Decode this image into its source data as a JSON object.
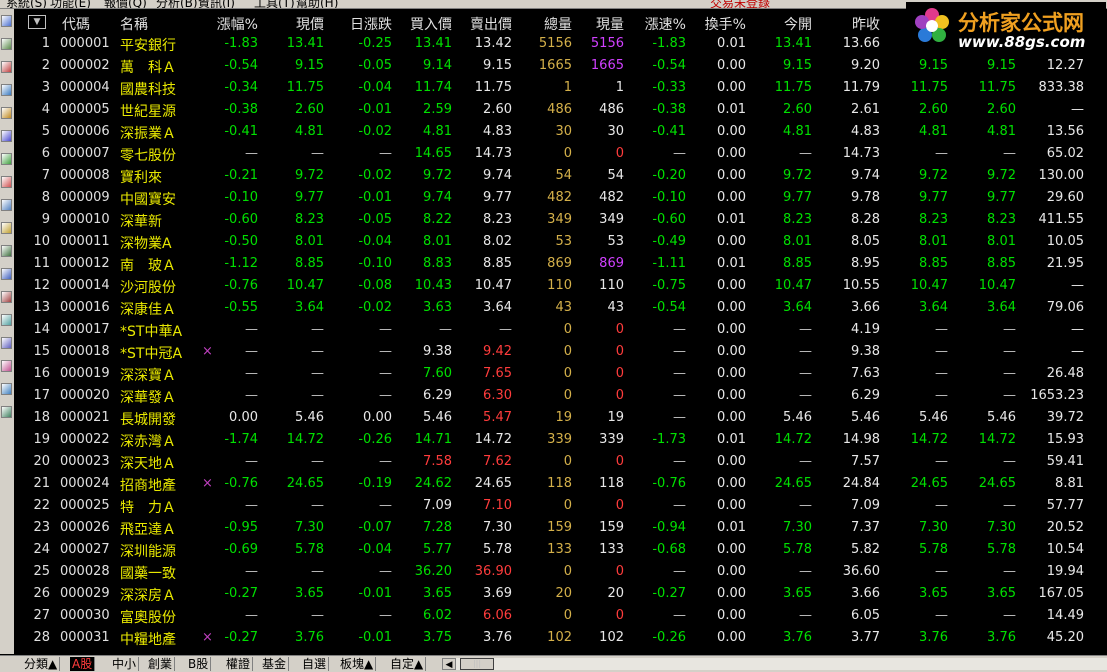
{
  "menubar": {
    "items": [
      "系統(S)",
      "功能(E)",
      "報價(Q)",
      "分析(B)",
      "資訊(I)",
      "工具(T)",
      "幫助(H)"
    ],
    "trade_login": "交易未登錄"
  },
  "logo": {
    "text": "分析家公式网",
    "url": "www.88gs.com"
  },
  "header": {
    "sort_icon": "▼",
    "columns": [
      "代碼",
      "名稱",
      "漲幅%",
      "現價",
      "日漲跌",
      "買入價",
      "賣出價",
      "總量",
      "現量",
      "漲速%",
      "換手%",
      "今開",
      "昨收"
    ]
  },
  "rows": [
    {
      "seq": "1",
      "code": "000001",
      "name": "平安銀行",
      "mark": "",
      "pct": "-1.83",
      "price": "13.41",
      "chg": "-0.25",
      "bid": "13.41",
      "ask": "13.42",
      "vol": "5156",
      "cur": "5156",
      "spd": "-1.83",
      "turn": "0.01",
      "open": "13.41",
      "prev": "13.66",
      "h": "",
      "l": "",
      "x": ""
    },
    {
      "seq": "2",
      "code": "000002",
      "name": "萬　科Ａ",
      "mark": "",
      "pct": "-0.54",
      "price": "9.15",
      "chg": "-0.05",
      "bid": "9.14",
      "ask": "9.15",
      "vol": "1665",
      "cur": "1665",
      "spd": "-0.54",
      "turn": "0.00",
      "open": "9.15",
      "prev": "9.20",
      "h": "9.15",
      "l": "9.15",
      "x": "12.27"
    },
    {
      "seq": "3",
      "code": "000004",
      "name": "國農科技",
      "mark": "",
      "pct": "-0.34",
      "price": "11.75",
      "chg": "-0.04",
      "bid": "11.74",
      "ask": "11.75",
      "vol": "1",
      "cur": "1",
      "spd": "-0.33",
      "turn": "0.00",
      "open": "11.75",
      "prev": "11.79",
      "h": "11.75",
      "l": "11.75",
      "x": "833.38"
    },
    {
      "seq": "4",
      "code": "000005",
      "name": "世紀星源",
      "mark": "",
      "pct": "-0.38",
      "price": "2.60",
      "chg": "-0.01",
      "bid": "2.59",
      "ask": "2.60",
      "vol": "486",
      "cur": "486",
      "spd": "-0.38",
      "turn": "0.01",
      "open": "2.60",
      "prev": "2.61",
      "h": "2.60",
      "l": "2.60",
      "x": "—"
    },
    {
      "seq": "5",
      "code": "000006",
      "name": "深振業Ａ",
      "mark": "",
      "pct": "-0.41",
      "price": "4.81",
      "chg": "-0.02",
      "bid": "4.81",
      "ask": "4.83",
      "vol": "30",
      "cur": "30",
      "spd": "-0.41",
      "turn": "0.00",
      "open": "4.81",
      "prev": "4.83",
      "h": "4.81",
      "l": "4.81",
      "x": "13.56"
    },
    {
      "seq": "6",
      "code": "000007",
      "name": "零七股份",
      "mark": "",
      "pct": "—",
      "price": "—",
      "chg": "—",
      "bid": "14.65",
      "ask": "14.73",
      "vol": "0",
      "cur": "0",
      "spd": "—",
      "turn": "0.00",
      "open": "—",
      "prev": "14.73",
      "h": "—",
      "l": "—",
      "x": "65.02"
    },
    {
      "seq": "7",
      "code": "000008",
      "name": "寶利來",
      "mark": "",
      "pct": "-0.21",
      "price": "9.72",
      "chg": "-0.02",
      "bid": "9.72",
      "ask": "9.74",
      "vol": "54",
      "cur": "54",
      "spd": "-0.20",
      "turn": "0.00",
      "open": "9.72",
      "prev": "9.74",
      "h": "9.72",
      "l": "9.72",
      "x": "130.00"
    },
    {
      "seq": "8",
      "code": "000009",
      "name": "中國寶安",
      "mark": "",
      "pct": "-0.10",
      "price": "9.77",
      "chg": "-0.01",
      "bid": "9.74",
      "ask": "9.77",
      "vol": "482",
      "cur": "482",
      "spd": "-0.10",
      "turn": "0.00",
      "open": "9.77",
      "prev": "9.78",
      "h": "9.77",
      "l": "9.77",
      "x": "29.60"
    },
    {
      "seq": "9",
      "code": "000010",
      "name": "深華新",
      "mark": "",
      "pct": "-0.60",
      "price": "8.23",
      "chg": "-0.05",
      "bid": "8.22",
      "ask": "8.23",
      "vol": "349",
      "cur": "349",
      "spd": "-0.60",
      "turn": "0.01",
      "open": "8.23",
      "prev": "8.28",
      "h": "8.23",
      "l": "8.23",
      "x": "411.55"
    },
    {
      "seq": "10",
      "code": "000011",
      "name": "深物業A",
      "mark": "",
      "pct": "-0.50",
      "price": "8.01",
      "chg": "-0.04",
      "bid": "8.01",
      "ask": "8.02",
      "vol": "53",
      "cur": "53",
      "spd": "-0.49",
      "turn": "0.00",
      "open": "8.01",
      "prev": "8.05",
      "h": "8.01",
      "l": "8.01",
      "x": "10.05"
    },
    {
      "seq": "11",
      "code": "000012",
      "name": "南　玻Ａ",
      "mark": "",
      "pct": "-1.12",
      "price": "8.85",
      "chg": "-0.10",
      "bid": "8.83",
      "ask": "8.85",
      "vol": "869",
      "cur": "869",
      "spd": "-1.11",
      "turn": "0.01",
      "open": "8.85",
      "prev": "8.95",
      "h": "8.85",
      "l": "8.85",
      "x": "21.95"
    },
    {
      "seq": "12",
      "code": "000014",
      "name": "沙河股份",
      "mark": "",
      "pct": "-0.76",
      "price": "10.47",
      "chg": "-0.08",
      "bid": "10.43",
      "ask": "10.47",
      "vol": "110",
      "cur": "110",
      "spd": "-0.75",
      "turn": "0.00",
      "open": "10.47",
      "prev": "10.55",
      "h": "10.47",
      "l": "10.47",
      "x": "—"
    },
    {
      "seq": "13",
      "code": "000016",
      "name": "深康佳Ａ",
      "mark": "",
      "pct": "-0.55",
      "price": "3.64",
      "chg": "-0.02",
      "bid": "3.63",
      "ask": "3.64",
      "vol": "43",
      "cur": "43",
      "spd": "-0.54",
      "turn": "0.00",
      "open": "3.64",
      "prev": "3.66",
      "h": "3.64",
      "l": "3.64",
      "x": "79.06"
    },
    {
      "seq": "14",
      "code": "000017",
      "name": "*ST中華A",
      "mark": "",
      "pct": "—",
      "price": "—",
      "chg": "—",
      "bid": "—",
      "ask": "—",
      "vol": "0",
      "cur": "0",
      "spd": "—",
      "turn": "0.00",
      "open": "—",
      "prev": "4.19",
      "h": "—",
      "l": "—",
      "x": "—"
    },
    {
      "seq": "15",
      "code": "000018",
      "name": "*ST中冠A",
      "mark": "×",
      "pct": "—",
      "price": "—",
      "chg": "—",
      "bid": "9.38",
      "ask": "9.42",
      "vol": "0",
      "cur": "0",
      "spd": "—",
      "turn": "0.00",
      "open": "—",
      "prev": "9.38",
      "h": "—",
      "l": "—",
      "x": "—"
    },
    {
      "seq": "16",
      "code": "000019",
      "name": "深深寶Ａ",
      "mark": "",
      "pct": "—",
      "price": "—",
      "chg": "—",
      "bid": "7.60",
      "ask": "7.65",
      "vol": "0",
      "cur": "0",
      "spd": "—",
      "turn": "0.00",
      "open": "—",
      "prev": "7.63",
      "h": "—",
      "l": "—",
      "x": "26.48"
    },
    {
      "seq": "17",
      "code": "000020",
      "name": "深華發Ａ",
      "mark": "",
      "pct": "—",
      "price": "—",
      "chg": "—",
      "bid": "6.29",
      "ask": "6.30",
      "vol": "0",
      "cur": "0",
      "spd": "—",
      "turn": "0.00",
      "open": "—",
      "prev": "6.29",
      "h": "—",
      "l": "—",
      "x": "1653.23"
    },
    {
      "seq": "18",
      "code": "000021",
      "name": "長城開發",
      "mark": "",
      "pct": "0.00",
      "price": "5.46",
      "chg": "0.00",
      "bid": "5.46",
      "ask": "5.47",
      "vol": "19",
      "cur": "19",
      "spd": "—",
      "turn": "0.00",
      "open": "5.46",
      "prev": "5.46",
      "h": "5.46",
      "l": "5.46",
      "x": "39.72"
    },
    {
      "seq": "19",
      "code": "000022",
      "name": "深赤灣Ａ",
      "mark": "",
      "pct": "-1.74",
      "price": "14.72",
      "chg": "-0.26",
      "bid": "14.71",
      "ask": "14.72",
      "vol": "339",
      "cur": "339",
      "spd": "-1.73",
      "turn": "0.01",
      "open": "14.72",
      "prev": "14.98",
      "h": "14.72",
      "l": "14.72",
      "x": "15.93"
    },
    {
      "seq": "20",
      "code": "000023",
      "name": "深天地Ａ",
      "mark": "",
      "pct": "—",
      "price": "—",
      "chg": "—",
      "bid": "7.58",
      "ask": "7.62",
      "vol": "0",
      "cur": "0",
      "spd": "—",
      "turn": "0.00",
      "open": "—",
      "prev": "7.57",
      "h": "—",
      "l": "—",
      "x": "59.41"
    },
    {
      "seq": "21",
      "code": "000024",
      "name": "招商地產",
      "mark": "×",
      "pct": "-0.76",
      "price": "24.65",
      "chg": "-0.19",
      "bid": "24.62",
      "ask": "24.65",
      "vol": "118",
      "cur": "118",
      "spd": "-0.76",
      "turn": "0.00",
      "open": "24.65",
      "prev": "24.84",
      "h": "24.65",
      "l": "24.65",
      "x": "8.81"
    },
    {
      "seq": "22",
      "code": "000025",
      "name": "特　力Ａ",
      "mark": "",
      "pct": "—",
      "price": "—",
      "chg": "—",
      "bid": "7.09",
      "ask": "7.10",
      "vol": "0",
      "cur": "0",
      "spd": "—",
      "turn": "0.00",
      "open": "—",
      "prev": "7.09",
      "h": "—",
      "l": "—",
      "x": "57.77"
    },
    {
      "seq": "23",
      "code": "000026",
      "name": "飛亞達Ａ",
      "mark": "",
      "pct": "-0.95",
      "price": "7.30",
      "chg": "-0.07",
      "bid": "7.28",
      "ask": "7.30",
      "vol": "159",
      "cur": "159",
      "spd": "-0.94",
      "turn": "0.01",
      "open": "7.30",
      "prev": "7.37",
      "h": "7.30",
      "l": "7.30",
      "x": "20.52"
    },
    {
      "seq": "24",
      "code": "000027",
      "name": "深圳能源",
      "mark": "",
      "pct": "-0.69",
      "price": "5.78",
      "chg": "-0.04",
      "bid": "5.77",
      "ask": "5.78",
      "vol": "133",
      "cur": "133",
      "spd": "-0.68",
      "turn": "0.00",
      "open": "5.78",
      "prev": "5.82",
      "h": "5.78",
      "l": "5.78",
      "x": "10.54"
    },
    {
      "seq": "25",
      "code": "000028",
      "name": "國藥一致",
      "mark": "",
      "pct": "—",
      "price": "—",
      "chg": "—",
      "bid": "36.20",
      "ask": "36.90",
      "vol": "0",
      "cur": "0",
      "spd": "—",
      "turn": "0.00",
      "open": "—",
      "prev": "36.60",
      "h": "—",
      "l": "—",
      "x": "19.94"
    },
    {
      "seq": "26",
      "code": "000029",
      "name": "深深房Ａ",
      "mark": "",
      "pct": "-0.27",
      "price": "3.65",
      "chg": "-0.01",
      "bid": "3.65",
      "ask": "3.69",
      "vol": "20",
      "cur": "20",
      "spd": "-0.27",
      "turn": "0.00",
      "open": "3.65",
      "prev": "3.66",
      "h": "3.65",
      "l": "3.65",
      "x": "167.05"
    },
    {
      "seq": "27",
      "code": "000030",
      "name": "富奧股份",
      "mark": "",
      "pct": "—",
      "price": "—",
      "chg": "—",
      "bid": "6.02",
      "ask": "6.06",
      "vol": "0",
      "cur": "0",
      "spd": "—",
      "turn": "0.00",
      "open": "—",
      "prev": "6.05",
      "h": "—",
      "l": "—",
      "x": "14.49"
    },
    {
      "seq": "28",
      "code": "000031",
      "name": "中糧地產",
      "mark": "×",
      "pct": "-0.27",
      "price": "3.76",
      "chg": "-0.01",
      "bid": "3.75",
      "ask": "3.76",
      "vol": "102",
      "cur": "102",
      "spd": "-0.26",
      "turn": "0.00",
      "open": "3.76",
      "prev": "3.77",
      "h": "3.76",
      "l": "3.76",
      "x": "45.20"
    }
  ],
  "tabs": [
    "分類▲",
    "A股",
    "中小",
    "創業",
    "B股",
    "權證",
    "基金",
    "自選",
    "板塊▲",
    "自定▲"
  ],
  "active_tab": 1,
  "scroll": {
    "left": "◀",
    "right": "▶",
    "thumb": "|||"
  },
  "colors": {
    "up": "#ff3c3c",
    "down": "#00e000",
    "flat": "#e8e8e8",
    "name": "#e8e800",
    "volume": "#d4b04a"
  }
}
